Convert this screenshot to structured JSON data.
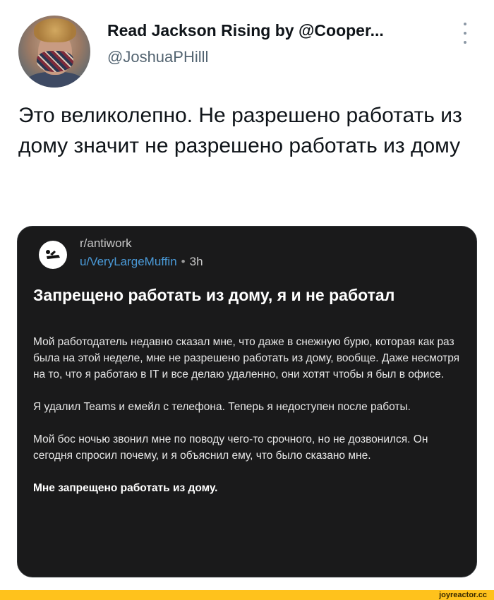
{
  "tweet": {
    "display_name": "Read Jackson Rising by @Cooper...",
    "handle": "@JoshuaPHilll",
    "text": "Это великолепно. Не разрешено работать из дому значит не разрешено работать из дому"
  },
  "reddit_post": {
    "subreddit": "r/antiwork",
    "username": "u/VeryLargeMuffin",
    "separator": "•",
    "time": "3h",
    "title": "Запрещено работать из дому, я и не работал",
    "paragraphs": [
      "Мой работодатель недавно сказал мне, что даже в снежную бурю, которая как раз была на этой неделе, мне не разрешено работать из дому, вообще. Даже несмотря на то, что я работаю в IT и все делаю удаленно, они хотят чтобы я был в офисе.",
      "Я удалил Teams и емейл с телефона. Теперь я недоступен после работы.",
      "Мой бос ночью звонил мне по поводу чего-то срочного, но не дозвонился. Он сегодня спросил почему, и я объяснил ему, что было сказано мне."
    ],
    "closing": "Мне запрещено работать из дому."
  },
  "footer": {
    "watermark": "joyreactor.cc",
    "bar_color": "#ffc21c"
  }
}
